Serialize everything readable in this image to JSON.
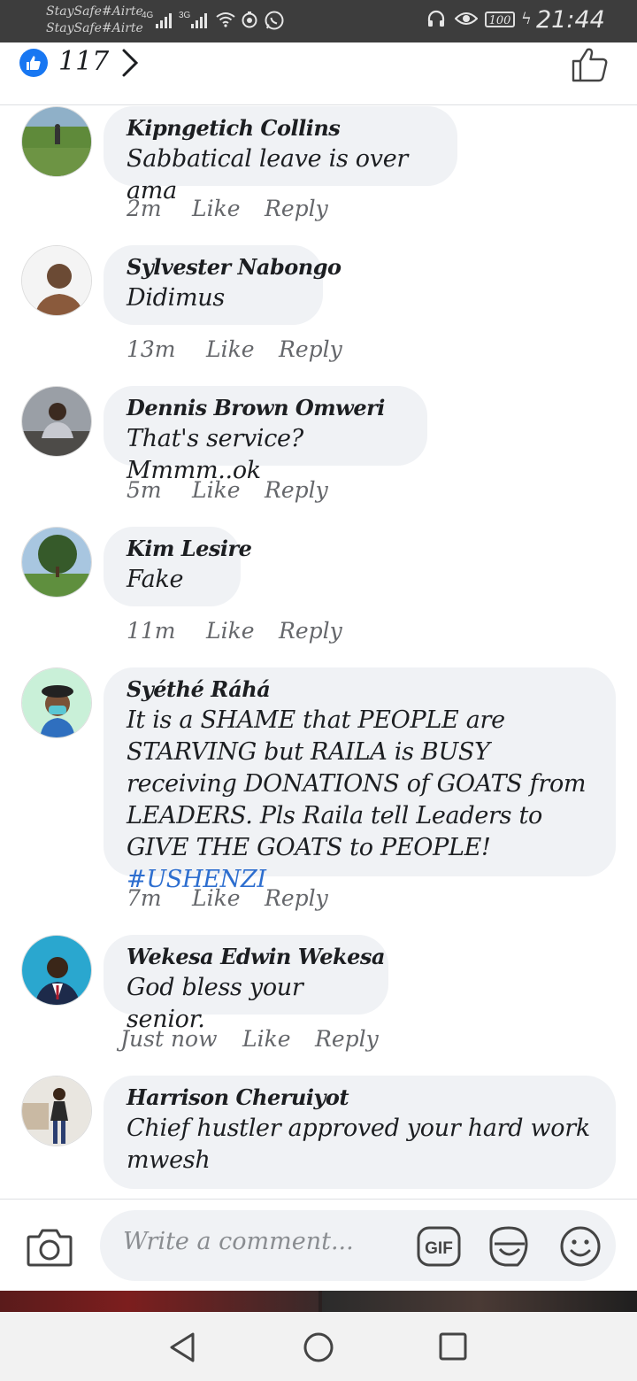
{
  "status_bar": {
    "carrier_1": "StaySafe#Airte",
    "carrier_2": "StaySafe#Airte",
    "net_1": "4G",
    "net_2": "3G",
    "battery": "100",
    "time": "21:44"
  },
  "reactions": {
    "count": "117",
    "icon": "like-icon"
  },
  "comments": [
    {
      "name": "Kipngetich Collins",
      "text": "Sabbatical leave is over ama",
      "time": "2m",
      "like": "Like",
      "reply": "Reply"
    },
    {
      "name": "Sylvester Nabongo",
      "text": "Didimus",
      "time": "13m",
      "like": "Like",
      "reply": "Reply"
    },
    {
      "name": "Dennis Brown Omweri",
      "text": "That's service? Mmmm..ok",
      "time": "5m",
      "like": "Like",
      "reply": "Reply"
    },
    {
      "name": "Kim Lesire",
      "text": "Fake",
      "time": "11m",
      "like": "Like",
      "reply": "Reply"
    },
    {
      "name": "Syéthé Ráhá",
      "text": "It is a SHAME that PEOPLE are STARVING but RAILA is BUSY receiving DONATIONS of GOATS from LEADERS. Pls Raila tell Leaders to GIVE THE GOATS to PEOPLE!",
      "hashtag": "#USHENZI",
      "time": "7m",
      "like": "Like",
      "reply": "Reply"
    },
    {
      "name": "Wekesa Edwin Wekesa",
      "text": "God bless your senior.",
      "time": "Just now",
      "like": "Like",
      "reply": "Reply"
    },
    {
      "name": "Harrison Cheruiyot",
      "text": "Chief hustler approved your hard work mwesh"
    }
  ],
  "composer": {
    "placeholder": "Write a comment...",
    "gif_label": "GIF"
  },
  "colors": {
    "accent": "#1877f2",
    "bubble": "#f0f2f5",
    "hashtag": "#2d6ecf"
  }
}
